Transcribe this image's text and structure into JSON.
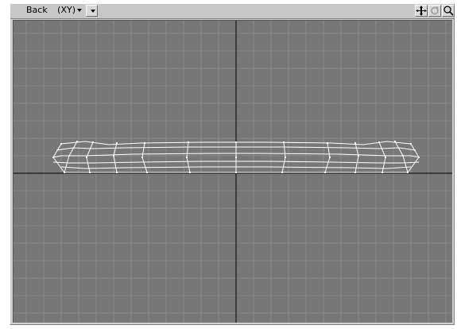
{
  "toolbar": {
    "view_label": "Back",
    "view_dropdown_value": "(XY)",
    "menu_icon": "chevron-down-icon",
    "icons": [
      "move-icon",
      "rotate-icon",
      "zoom-icon"
    ]
  },
  "colors": {
    "viewport_bg": "#777777",
    "grid_line": "#888888",
    "axis_line": "#000000",
    "wireframe": "#ffffff"
  }
}
